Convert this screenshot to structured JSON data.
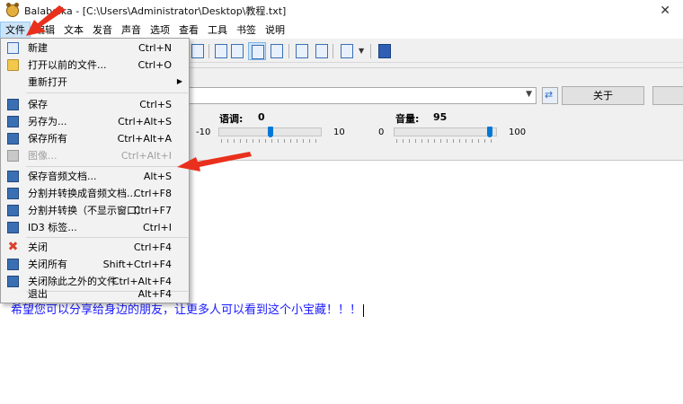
{
  "titlebar": {
    "title": "Balabolka - [C:\\Users\\Administrator\\Desktop\\教程.txt]"
  },
  "menubar": {
    "items": [
      "文件",
      "编辑",
      "文本",
      "发音",
      "声音",
      "选项",
      "查看",
      "工具",
      "书签",
      "说明"
    ]
  },
  "voice": {
    "about_label": "关于"
  },
  "sliders": {
    "pitch": {
      "label": "语调:",
      "value": "0",
      "min": "-10",
      "max": "10"
    },
    "volume": {
      "label": "音量:",
      "value": "95",
      "min": "0",
      "max": "100"
    }
  },
  "editor": {
    "text": "希望您可以分享给身边的朋友，让更多人可以看到这个小宝藏！！！"
  },
  "file_menu": {
    "items": [
      {
        "label": "新建",
        "shortcut": "Ctrl+N",
        "icon": "new-doc-icon"
      },
      {
        "label": "打开以前的文件...",
        "shortcut": "Ctrl+O",
        "icon": "open-folder-icon"
      },
      {
        "label": "重新打开",
        "shortcut": "",
        "icon": ""
      },
      {
        "label": "保存",
        "shortcut": "Ctrl+S",
        "icon": "save-icon"
      },
      {
        "label": "另存为...",
        "shortcut": "Ctrl+Alt+S",
        "icon": "save-as-icon"
      },
      {
        "label": "保存所有",
        "shortcut": "Ctrl+Alt+A",
        "icon": "save-all-icon"
      },
      {
        "label": "图像...",
        "shortcut": "Ctrl+Alt+I",
        "icon": "image-icon"
      },
      {
        "label": "保存音频文档...",
        "shortcut": "Alt+S",
        "icon": "save-audio-icon"
      },
      {
        "label": "分割并转换成音频文档...",
        "shortcut": "Ctrl+F8",
        "icon": "split-convert-icon"
      },
      {
        "label": "分割并转换（不显示窗口）",
        "shortcut": "Ctrl+F7",
        "icon": "split-convert-hidden-icon"
      },
      {
        "label": "ID3 标签...",
        "shortcut": "Ctrl+I",
        "icon": "id3-tag-icon"
      },
      {
        "label": "关闭",
        "shortcut": "Ctrl+F4",
        "icon": "close-icon"
      },
      {
        "label": "关闭所有",
        "shortcut": "Shift+Ctrl+F4",
        "icon": "close-all-icon"
      },
      {
        "label": "关闭除此之外的文件",
        "shortcut": "Ctrl+Alt+F4",
        "icon": "close-others-icon"
      },
      {
        "label": "退出",
        "shortcut": "Alt+F4",
        "icon": ""
      }
    ]
  },
  "colors": {
    "accent": "#0078d7",
    "editor_text": "#1a1aff",
    "annotation": "#e8301c"
  }
}
